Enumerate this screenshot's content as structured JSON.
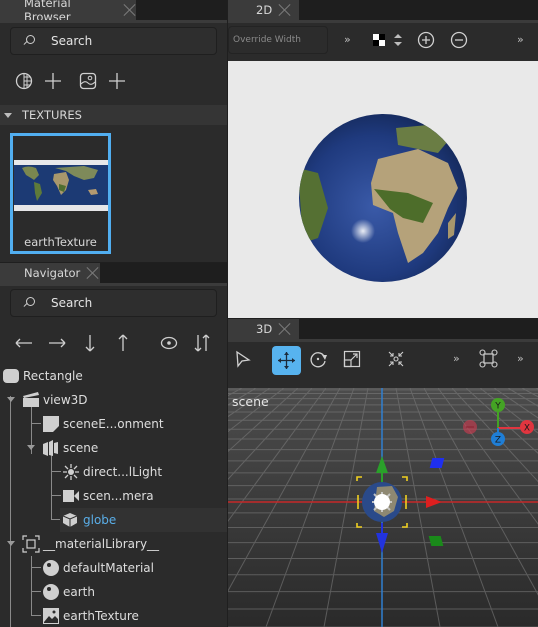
{
  "material_browser": {
    "tab_label": "Material Browser",
    "search_placeholder": "Search",
    "toolbar_icons": [
      "material-sphere-icon",
      "add-icon",
      "texture-image-icon",
      "add-icon"
    ],
    "section_title": "TEXTURES",
    "textures": [
      {
        "name": "earthTexture",
        "selected": true
      }
    ],
    "accent_color": "#51aef0"
  },
  "navigator": {
    "tab_label": "Navigator",
    "search_placeholder": "Search",
    "toolbar_icons": [
      "arrow-left-icon",
      "arrow-right-icon",
      "arrow-down-icon",
      "arrow-up-icon",
      "eye-icon",
      "sort-icon"
    ],
    "tree": [
      {
        "label": "Rectangle",
        "icon": "rectangle-icon",
        "depth": 0,
        "expanded": null
      },
      {
        "label": "view3D",
        "icon": "view3d-icon",
        "depth": 0,
        "expanded": true
      },
      {
        "label": "sceneE...onment",
        "icon": "scene-environment-icon",
        "depth": 1,
        "expanded": null
      },
      {
        "label": "scene",
        "icon": "scene-icon",
        "depth": 1,
        "expanded": true
      },
      {
        "label": "direct...lLight",
        "icon": "light-icon",
        "depth": 2,
        "expanded": null
      },
      {
        "label": "scen...mera",
        "icon": "camera-icon",
        "depth": 2,
        "expanded": null
      },
      {
        "label": "globe",
        "icon": "model-icon",
        "depth": 2,
        "expanded": null,
        "selected": true
      },
      {
        "label": "__materialLibrary__",
        "icon": "material-library-icon",
        "depth": 0,
        "expanded": true
      },
      {
        "label": "defaultMaterial",
        "icon": "material-icon",
        "depth": 1,
        "expanded": null
      },
      {
        "label": "earth",
        "icon": "material-icon",
        "depth": 1,
        "expanded": null
      },
      {
        "label": "earthTexture",
        "icon": "texture-icon",
        "depth": 1,
        "expanded": null
      }
    ],
    "selection_color": "#5aaee8"
  },
  "view2d": {
    "tab_label": "2D",
    "override_width_placeholder": "Override Width",
    "more_label": "»",
    "toolbar_icons": [
      "background-color-icon",
      "spin-icon",
      "zoom-in-icon",
      "zoom-out-icon"
    ]
  },
  "view3d": {
    "tab_label": "3D",
    "more_label": "»",
    "toolbar_icons": [
      "select-icon",
      "move-icon",
      "rotate-icon",
      "scale-icon",
      "fit-icon",
      "edit-camera-icon"
    ],
    "active_tool": "move-icon",
    "scene_label": "scene",
    "gizmo_labels": {
      "x": "X",
      "y": "Y",
      "z": "Z"
    },
    "axis_colors": {
      "x": "#e0353f",
      "y": "#44a324",
      "z": "#1f7ed6"
    },
    "active_color": "#57b3ef"
  }
}
